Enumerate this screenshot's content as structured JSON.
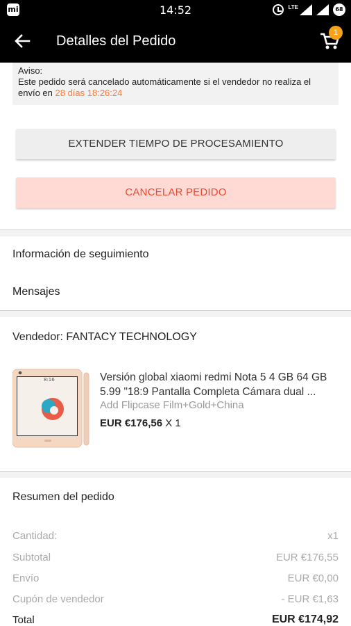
{
  "status_bar": {
    "time": "14:52",
    "network": "LTE",
    "battery": "68",
    "app_icon": "mi"
  },
  "header": {
    "title": "Detalles del Pedido",
    "cart_count": "1"
  },
  "notice": {
    "label": "Aviso:",
    "text": "Este pedido será cancelado automáticamente si el vendedor no realiza el envío en",
    "countdown": "28 días 18:26:24"
  },
  "actions": {
    "extend_label": "EXTENDER TIEMPO DE PROCESAMIENTO",
    "cancel_label": "CANCELAR PEDIDO"
  },
  "links": {
    "tracking": "Información de seguimiento",
    "messages": "Mensajes"
  },
  "seller": {
    "label": "Vendedor: FANTACY  TECHNOLOGY"
  },
  "product": {
    "title": "Versión global xiaomi redmi Nota 5 4 GB 64 GB 5.99 \"18:9 Pantalla Completa Cámara dual ...",
    "variant": "Add Flipcase Film+Gold+China",
    "price": "EUR €176,56",
    "quantity": "X 1",
    "screen_time": "8:16"
  },
  "summary": {
    "title": "Resumen del pedido",
    "rows": [
      {
        "label": "Cantidad:",
        "value": "x1"
      },
      {
        "label": "Subtotal",
        "value": "EUR €176,55"
      },
      {
        "label": "Envío",
        "value": "EUR €0,00"
      },
      {
        "label": "Cupón de vendedor",
        "value": "- EUR €1,63"
      }
    ],
    "total_label": "Total",
    "total_value": "EUR €174,92"
  },
  "colors": {
    "accent_orange": "#ff7a33",
    "cancel_text": "#e84a34",
    "cancel_bg": "#ffd9d4",
    "badge": "#f7a21b"
  }
}
